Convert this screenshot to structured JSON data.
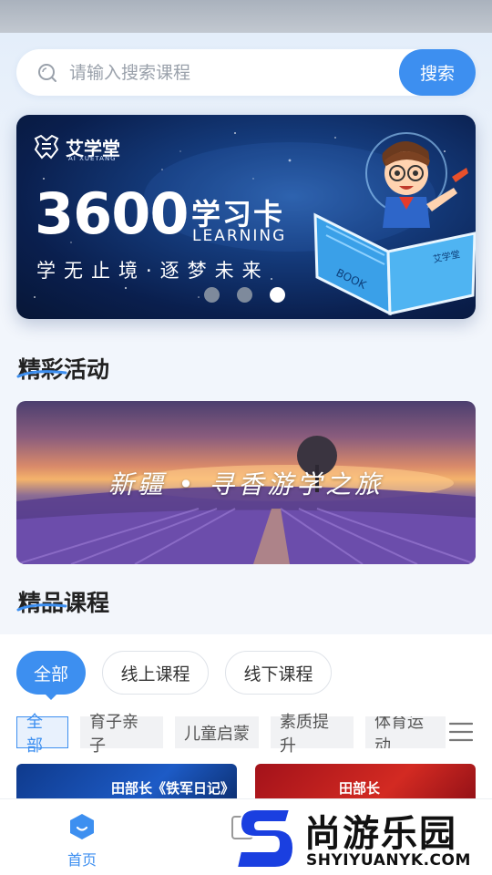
{
  "search": {
    "placeholder": "请输入搜索课程",
    "button_label": "搜索"
  },
  "banner": {
    "logo_text": "艾学堂",
    "logo_sub": "AI XUETANG",
    "number": "3600",
    "card_title": "学习卡",
    "learning": "LEARNING",
    "slogan": "学无止境·逐梦未来",
    "book_label": "BOOK",
    "book_brand": "艾学堂",
    "slide_count": 3,
    "active_slide_index": 2
  },
  "activities": {
    "title": "精彩活动",
    "card_text": "新疆 • 寻香游学之旅"
  },
  "courses": {
    "title": "精品课程",
    "filters": [
      {
        "label": "全部",
        "active": true
      },
      {
        "label": "线上课程",
        "active": false
      },
      {
        "label": "线下课程",
        "active": false
      }
    ],
    "tags": [
      {
        "label": "全部",
        "active": true
      },
      {
        "label": "育子亲子",
        "active": false
      },
      {
        "label": "儿童启蒙",
        "active": false
      },
      {
        "label": "素质提升",
        "active": false
      },
      {
        "label": "体育运动",
        "active": false
      }
    ],
    "cards": [
      {
        "title": "田部长《铁军日记》"
      },
      {
        "title": "田部长"
      }
    ]
  },
  "bottom_nav": {
    "home_label": "首页"
  },
  "watermark": {
    "brand": "尚游乐园",
    "url": "SHYIYUANYK.COM"
  },
  "colors": {
    "accent": "#3d8ff0",
    "banner_dark": "#0a1f4e"
  }
}
